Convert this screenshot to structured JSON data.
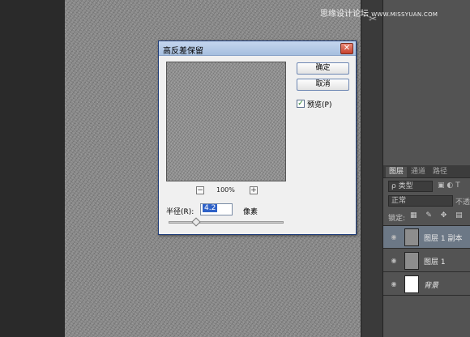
{
  "watermark": {
    "text": "思缘设计论坛",
    "url": "WWW.MISSYUAN.COM"
  },
  "tools": {
    "tool_icon": "scissors-icon"
  },
  "dialog": {
    "title": "高反差保留",
    "close_icon": "close-icon",
    "ok_label": "确定",
    "cancel_label": "取消",
    "preview_label": "预览(P)",
    "preview_checked": true,
    "zoom_level": "100%",
    "zoom_out": "−",
    "zoom_in": "+",
    "radius_label": "半径(R):",
    "radius_value": "4.2",
    "radius_unit": "像素",
    "radius_slider_fraction": 0.24
  },
  "layers_panel": {
    "tabs": [
      {
        "label": "图层",
        "active": true
      },
      {
        "label": "通道",
        "active": false
      },
      {
        "label": "路径",
        "active": false
      }
    ],
    "kind_label": "ρ 类型",
    "kind_icons": "▣ ◐ T",
    "blend_mode": "正常",
    "opacity_label": "不透",
    "lock_label": "锁定:",
    "lock_icons": "▦ ✎ ✥ ▤",
    "layers": [
      {
        "name": "图层 1 副本",
        "thumb": "gray",
        "selected": true,
        "italic": false
      },
      {
        "name": "图层 1",
        "thumb": "gray",
        "selected": false,
        "italic": false
      },
      {
        "name": "背景",
        "thumb": "white",
        "selected": false,
        "italic": true
      }
    ]
  }
}
